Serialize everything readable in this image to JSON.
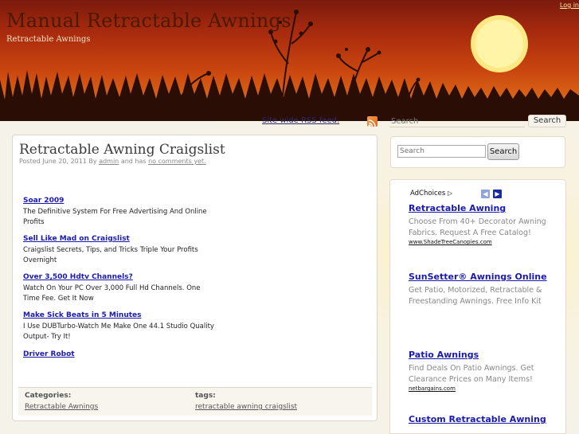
{
  "header": {
    "site_title": "Manual Retractable Awnings",
    "site_description": "Retractable Awnings",
    "login_link": "Log in"
  },
  "nav": {
    "rss_label": "Site wide RSS feed.",
    "search_placeholder": "Search",
    "search_button": "Search"
  },
  "post": {
    "title": "Retractable Awning Craigslist",
    "meta": {
      "prefix": "Posted June 20, 2011 By",
      "author": "admin",
      "middle": "and has",
      "comments": "no comments yet."
    },
    "ads": [
      {
        "title": "Soar 2009",
        "text": "The Definitive System For Free Advertising And Online Profits"
      },
      {
        "title": "Sell Like Mad on Craigslist",
        "text": "Craigslist Secrets, Tips, and Tricks Triple Your Profits Overnight"
      },
      {
        "title": "Over 3,500 Hdtv Channels?",
        "text": "Watch On Your PC Over 3,000 Full Hd Channels. One Time Fee. Get It Now"
      },
      {
        "title": "Make Sick Beats in 5 Minutes",
        "text": "I Use DUBTurbo-Watch Me Make One 44.1 Studio Quality Output- Try It!"
      },
      {
        "title": "Driver Robot",
        "text": ""
      }
    ],
    "footer": {
      "categories_label": "Categories:",
      "category": "Retractable Awnings",
      "tags_label": "tags:",
      "tag": "retractable awning craigslist"
    }
  },
  "sidebar": {
    "search_placeholder": "Search",
    "search_button": "Search",
    "adchoices_label": "AdChoices",
    "ads": [
      {
        "title": "Retractable Awning",
        "text": "Choose From 40+ Decorator Awning Fabrics. Request A Free Catalog!",
        "url": "www.ShadeTreeCanopies.com"
      },
      {
        "title": "SunSetter® Awnings Online",
        "text": "Get Patio, Motorized, Retractable & Freestanding Awnings. Free Info Kit",
        "url": ""
      },
      {
        "title": "Patio Awnings",
        "text": "Find Deals On Patio Awnings. Get Clearance Prices on Many Items!",
        "url": "netbargains.com"
      },
      {
        "title": "Custom Retractable Awning",
        "text": "",
        "url": ""
      }
    ]
  },
  "icons": {
    "rss": "rss-icon",
    "adchoices": "adchoices-triangle-icon",
    "prev": "chevron-left-icon",
    "next": "chevron-right-icon"
  },
  "colors": {
    "header_dark": "#7a1a0d",
    "header_mid": "#c9450f",
    "header_light": "#e88a25",
    "ad_link": "#1a1ab0",
    "page_bg": "#f5f2ea"
  }
}
